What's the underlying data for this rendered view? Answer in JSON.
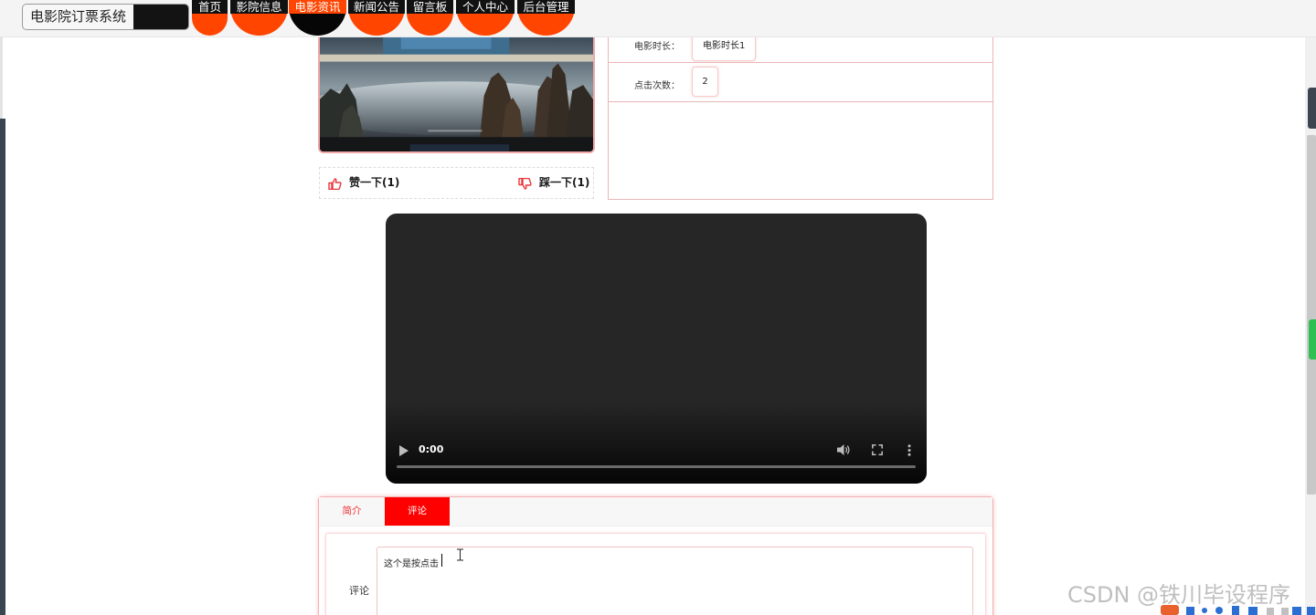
{
  "header": {
    "site_title": "电影院订票系统",
    "nav": [
      {
        "label": "首页"
      },
      {
        "label": "影院信息"
      },
      {
        "label": "电影资讯",
        "active": true
      },
      {
        "label": "新闻公告"
      },
      {
        "label": "留言板"
      },
      {
        "label": "个人中心"
      },
      {
        "label": "后台管理"
      }
    ]
  },
  "votes": {
    "like_label": "赞一下(1)",
    "dislike_label": "踩一下(1)"
  },
  "details": [
    {
      "label": "电影时长：",
      "value": "电影时长1"
    },
    {
      "label": "点击次数：",
      "value": "2"
    }
  ],
  "video": {
    "time": "0:00"
  },
  "tabs": [
    {
      "label": "简介"
    },
    {
      "label": "评论",
      "active": true
    }
  ],
  "comment": {
    "label": "评论",
    "value": "这个是按点击"
  },
  "watermark": "CSDN @铁川毕设程序",
  "colors": {
    "accent": "#ff4500",
    "tab_active": "#ff0000",
    "nav_label_bg": "#111111",
    "border_pink": "#eab5b5"
  }
}
